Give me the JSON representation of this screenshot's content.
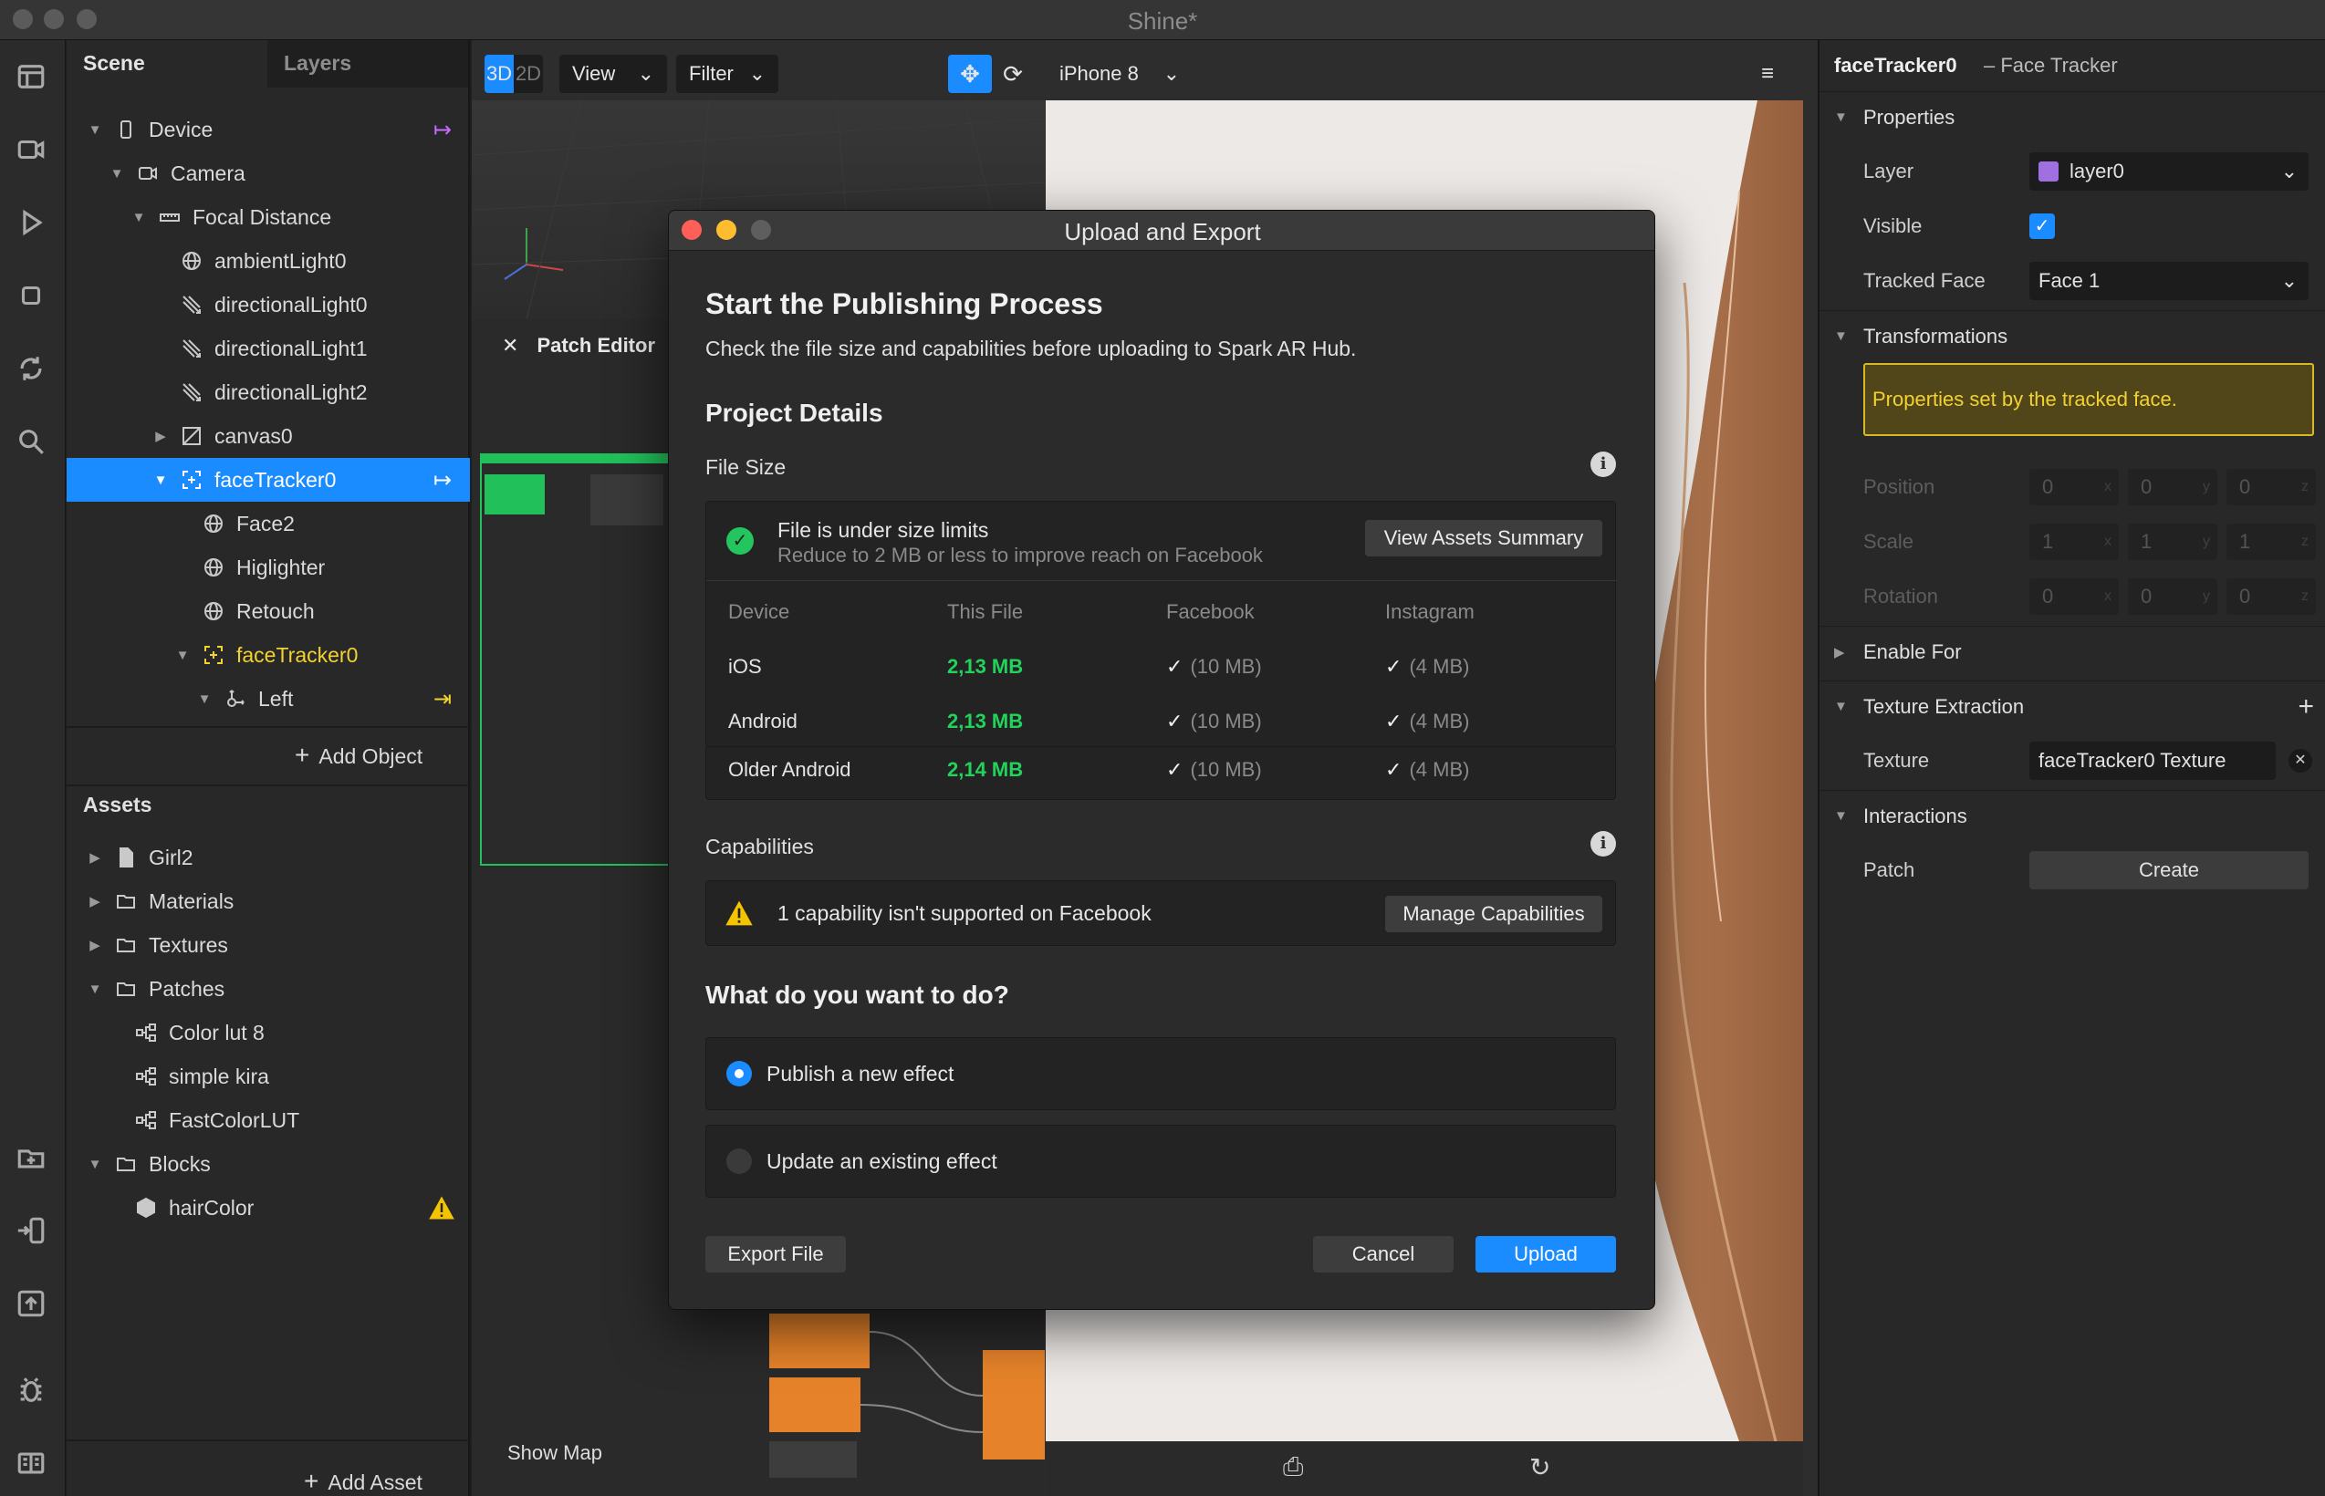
{
  "app": {
    "title": "Shine*"
  },
  "scene_panel": {
    "tabs": [
      "Scene",
      "Layers"
    ],
    "tree": [
      {
        "label": "Device"
      },
      {
        "label": "Camera"
      },
      {
        "label": "Focal Distance"
      },
      {
        "label": "ambientLight0"
      },
      {
        "label": "directionalLight0"
      },
      {
        "label": "directionalLight1"
      },
      {
        "label": "directionalLight2"
      },
      {
        "label": "canvas0"
      },
      {
        "label": "faceTracker0"
      },
      {
        "label": "Face2"
      },
      {
        "label": "Higlighter"
      },
      {
        "label": "Retouch"
      },
      {
        "label": "faceTracker0"
      },
      {
        "label": "Left"
      }
    ],
    "add_object": "Add Object",
    "assets_title": "Assets",
    "assets": [
      {
        "label": "Girl2"
      },
      {
        "label": "Materials"
      },
      {
        "label": "Textures"
      },
      {
        "label": "Patches"
      },
      {
        "label": "Color lut 8"
      },
      {
        "label": "simple kira"
      },
      {
        "label": "FastColorLUT"
      },
      {
        "label": "Blocks"
      },
      {
        "label": "hairColor"
      }
    ],
    "add_asset": "Add Asset"
  },
  "viewport": {
    "mode_3d": "3D",
    "mode_2d": "2D",
    "view_menu": "View",
    "filter_menu": "Filter",
    "device": "iPhone 8",
    "patch_editor_title": "Patch Editor",
    "show_map": "Show Map"
  },
  "inspector": {
    "object_name": "faceTracker0",
    "object_type": "– Face Tracker",
    "properties_title": "Properties",
    "layer_label": "Layer",
    "layer_value": "layer0",
    "layer_color": "#a06fe0",
    "visible_label": "Visible",
    "tracked_face_label": "Tracked Face",
    "tracked_face_value": "Face 1",
    "transformations_title": "Transformations",
    "transform_note": "Properties set by the tracked face.",
    "position_label": "Position",
    "scale_label": "Scale",
    "rotation_label": "Rotation",
    "position": [
      "0",
      "0",
      "0"
    ],
    "scale": [
      "1",
      "1",
      "1"
    ],
    "rotation": [
      "0",
      "0",
      "0"
    ],
    "axes": [
      "x",
      "y",
      "z"
    ],
    "enable_for_title": "Enable For",
    "texture_extraction_title": "Texture Extraction",
    "texture_label": "Texture",
    "texture_value": "faceTracker0 Texture",
    "interactions_title": "Interactions",
    "patch_label": "Patch",
    "create_button": "Create"
  },
  "modal": {
    "title": "Upload and Export",
    "heading": "Start the Publishing Process",
    "subheading": "Check the file size and capabilities before uploading to Spark AR Hub.",
    "project_details": "Project Details",
    "file_size_label": "File Size",
    "size_status": "File is under size limits",
    "size_hint": "Reduce to 2 MB or less to improve reach on Facebook",
    "view_assets_button": "View Assets Summary",
    "table_headers": [
      "Device",
      "This File",
      "Facebook",
      "Instagram"
    ],
    "table_rows": [
      {
        "device": "iOS",
        "this_file": "2,13 MB",
        "facebook": "(10 MB)",
        "instagram": "(4 MB)"
      },
      {
        "device": "Android",
        "this_file": "2,13 MB",
        "facebook": "(10 MB)",
        "instagram": "(4 MB)"
      },
      {
        "device": "Older Android",
        "this_file": "2,14 MB",
        "facebook": "(10 MB)",
        "instagram": "(4 MB)"
      }
    ],
    "capabilities_label": "Capabilities",
    "capability_warning": "1 capability isn't supported on Facebook",
    "manage_capabilities_button": "Manage Capabilities",
    "question": "What do you want to do?",
    "option_publish": "Publish a new effect",
    "option_update": "Update an existing effect",
    "export_button": "Export File",
    "cancel_button": "Cancel",
    "upload_button": "Upload"
  },
  "colors": {
    "accent": "#1a8cff",
    "selection_yellow": "#f2d230",
    "success_green": "#22d35b",
    "warning_yellow": "#f5c400",
    "close_red": "#fe5f57",
    "minimize_yellow": "#febc2e"
  }
}
